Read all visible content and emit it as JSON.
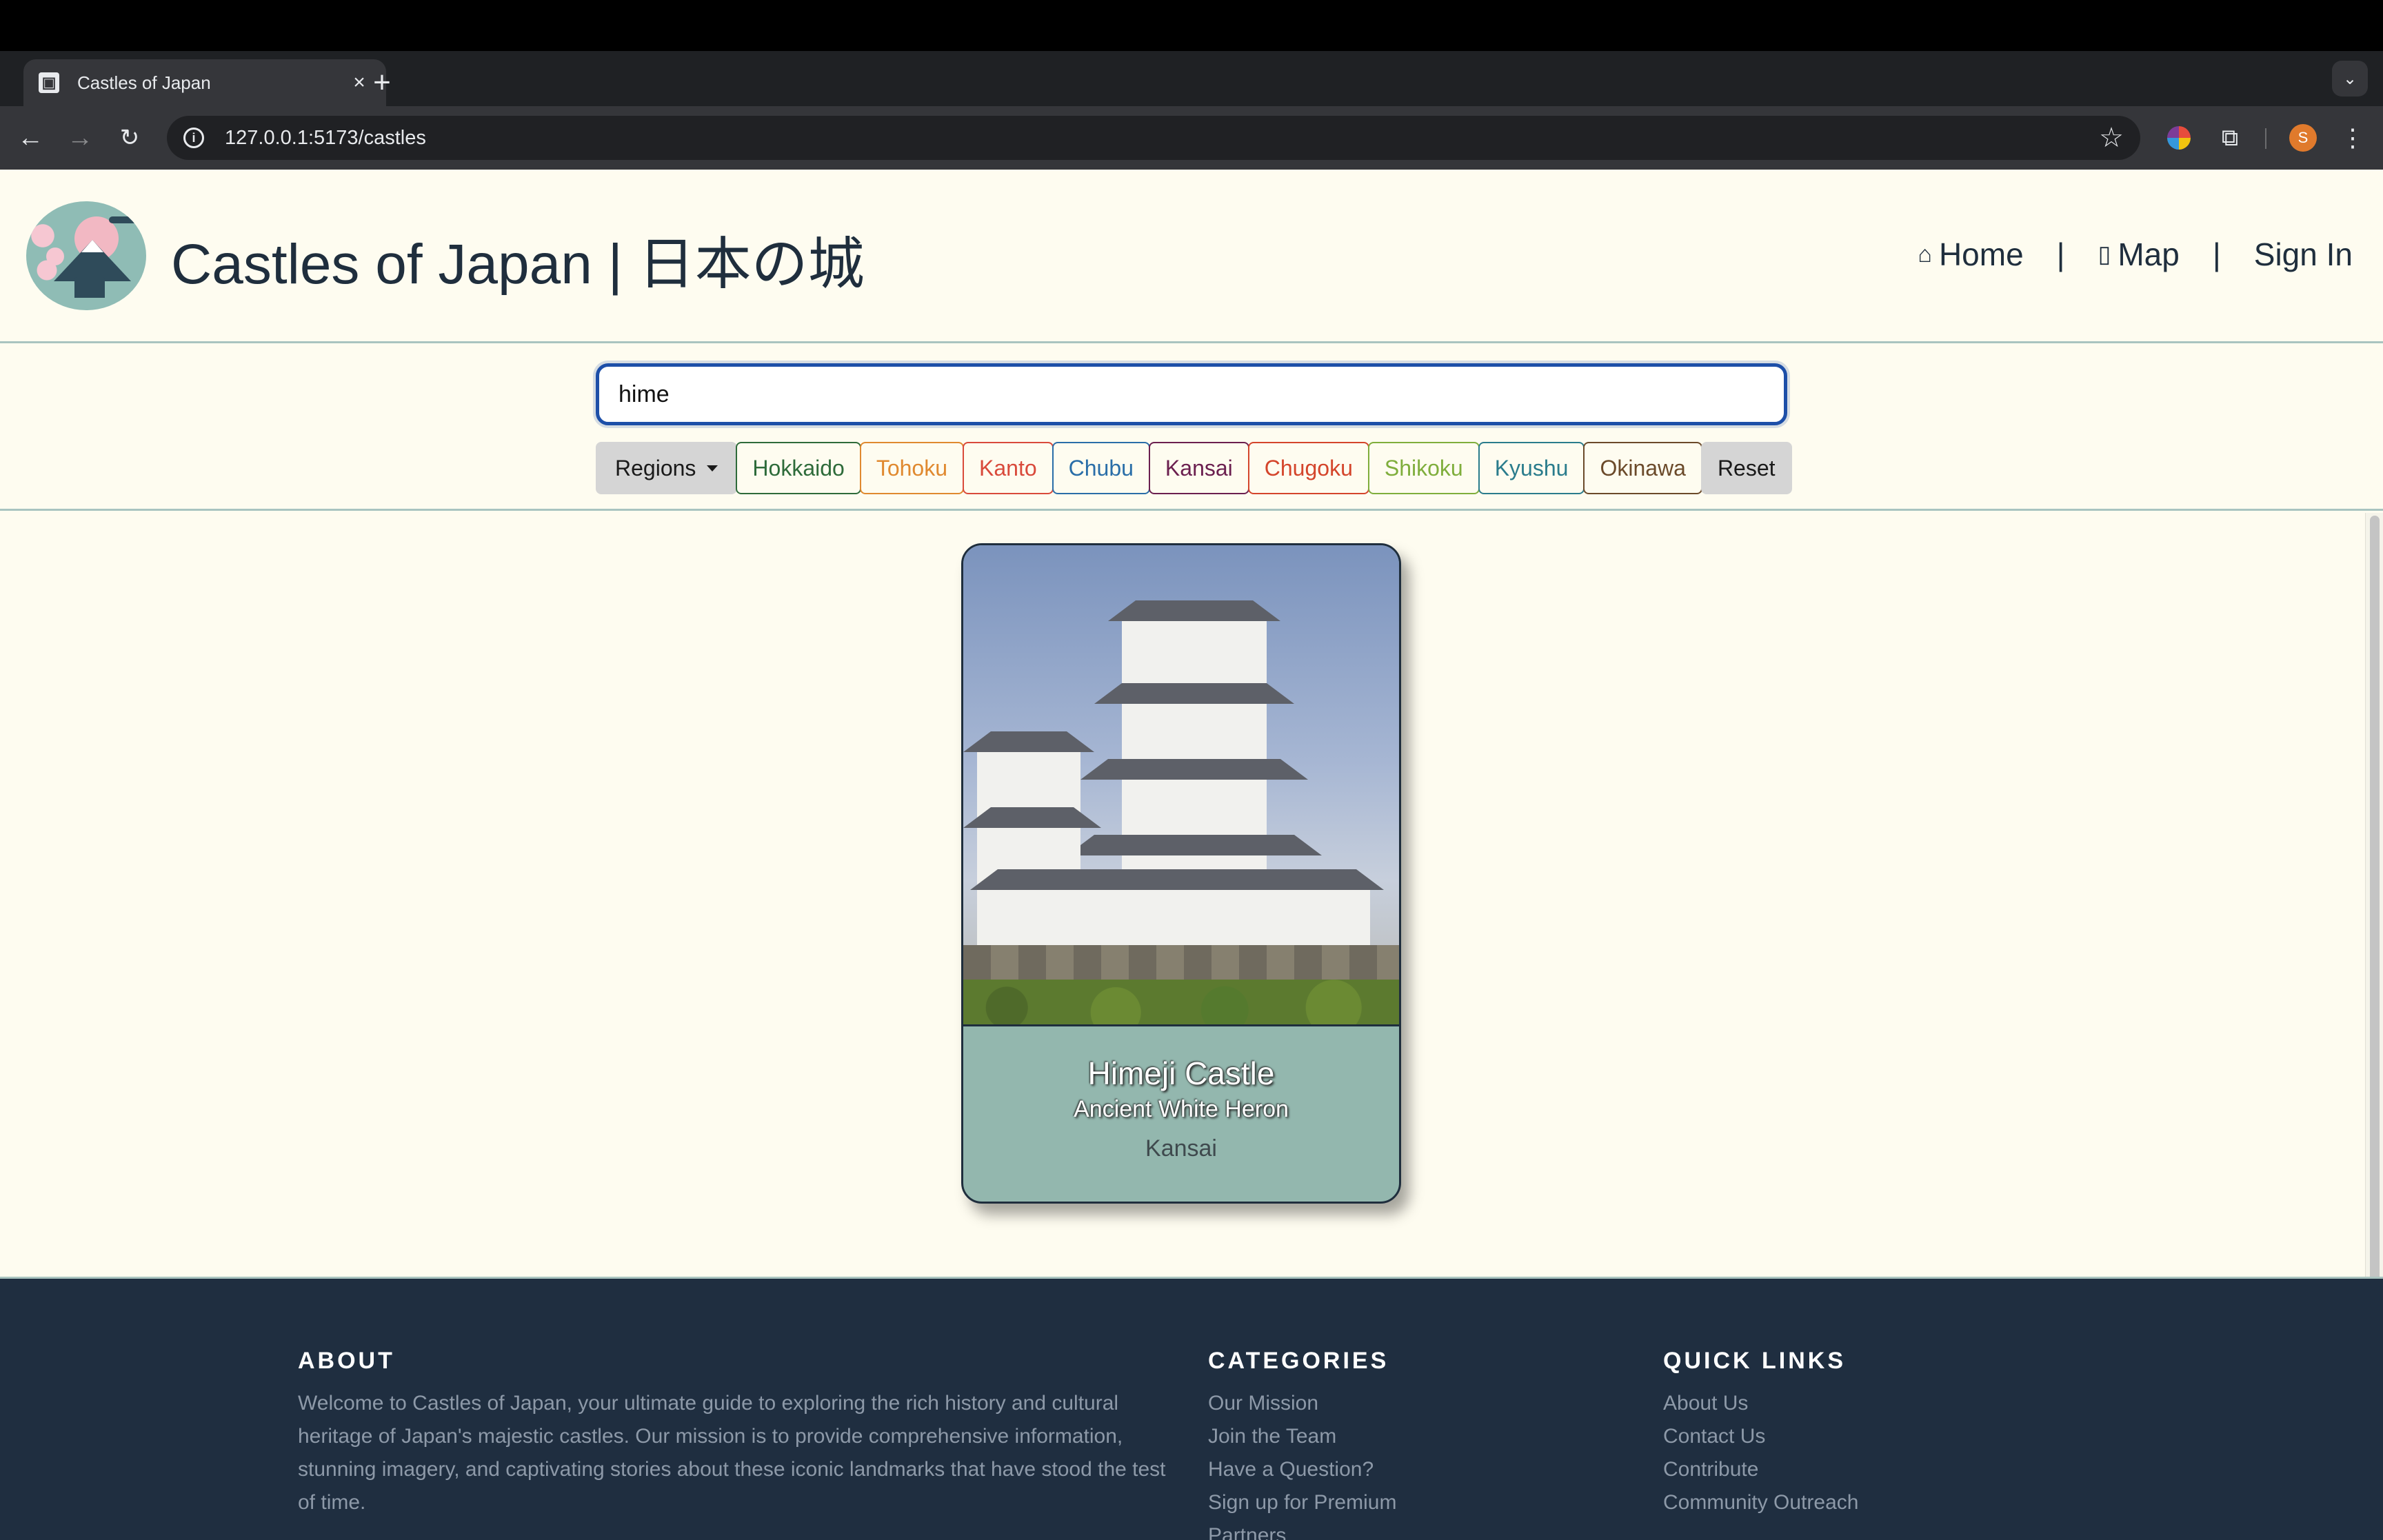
{
  "browser": {
    "tab_title": "Castles of Japan",
    "url": "127.0.0.1:5173/castles",
    "avatar_letter": "S"
  },
  "header": {
    "title": "Castles of Japan | 日本の城",
    "nav": {
      "home": "Home",
      "map": "Map",
      "sign_in": "Sign In",
      "separator": "|"
    }
  },
  "search": {
    "value": "hime",
    "regions_label": "Regions",
    "reset_label": "Reset",
    "regions": [
      {
        "label": "Hokkaido",
        "color": "#2e6b3a"
      },
      {
        "label": "Tohoku",
        "color": "#e0892f"
      },
      {
        "label": "Kanto",
        "color": "#d94a3b"
      },
      {
        "label": "Chubu",
        "color": "#2a6ea8"
      },
      {
        "label": "Kansai",
        "color": "#6b1f4f"
      },
      {
        "label": "Chugoku",
        "color": "#d4452b"
      },
      {
        "label": "Shikoku",
        "color": "#7fae3c"
      },
      {
        "label": "Kyushu",
        "color": "#2a7c8c"
      },
      {
        "label": "Okinawa",
        "color": "#6b4a2a"
      }
    ]
  },
  "results": [
    {
      "name": "Himeji Castle",
      "subtitle": "Ancient White Heron",
      "region": "Kansai"
    }
  ],
  "footer": {
    "about": {
      "heading": "ABOUT",
      "text": "Welcome to Castles of Japan, your ultimate guide to exploring the rich history and cultural heritage of Japan's majestic castles. Our mission is to provide comprehensive information, stunning imagery, and captivating stories about these iconic landmarks that have stood the test of time."
    },
    "categories": {
      "heading": "CATEGORIES",
      "links": [
        "Our Mission",
        "Join the Team",
        "Have a Question?",
        "Sign up for Premium",
        "Partners"
      ]
    },
    "quick_links": {
      "heading": "QUICK LINKS",
      "links": [
        "About Us",
        "Contact Us",
        "Contribute",
        "Community Outreach"
      ]
    }
  },
  "colors": {
    "page_bg": "#fefcf0",
    "accent_teal": "#a9c4c0",
    "card_bg": "#93b7ae",
    "footer_bg": "#1f2e40",
    "title_color": "#1f2e3d"
  }
}
